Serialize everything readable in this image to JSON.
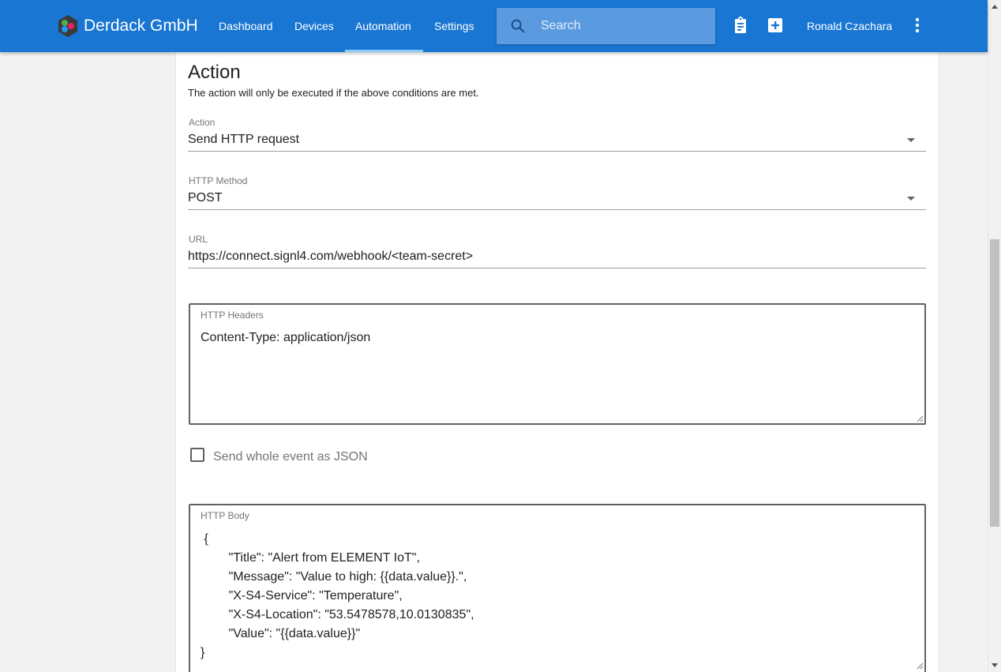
{
  "header": {
    "brand": "Derdack GmbH",
    "nav": [
      {
        "label": "Dashboard"
      },
      {
        "label": "Devices"
      },
      {
        "label": "Automation",
        "active": true
      },
      {
        "label": "Settings"
      }
    ],
    "search_placeholder": "Search",
    "user_name": "Ronald Czachara",
    "icons": [
      "clipboard-icon",
      "add-box-icon",
      "more-vert-icon"
    ],
    "brand_color": "#1976d2"
  },
  "action_section": {
    "title": "Action",
    "subtitle": "The action will only be executed if the above conditions are met.",
    "action_field": {
      "label": "Action",
      "value": "Send HTTP request"
    },
    "method_field": {
      "label": "HTTP Method",
      "value": "POST"
    },
    "url_field": {
      "label": "URL",
      "value": "https://connect.signl4.com/webhook/<team-secret>"
    },
    "headers_field": {
      "label": "HTTP Headers",
      "value": "Content-Type: application/json"
    },
    "whole_event_checkbox": {
      "label": "Send whole event as JSON",
      "checked": false
    },
    "body_field": {
      "label": "HTTP Body",
      "value": " {\n        \"Title\": \"Alert from ELEMENT IoT\",\n        \"Message\": \"Value to high: {{data.value}}.\",\n        \"X-S4-Service\": \"Temperature\",\n        \"X-S4-Location\": \"53.5478578,10.0130835\",\n        \"Value\": \"{{data.value}}\"\n}"
    }
  }
}
